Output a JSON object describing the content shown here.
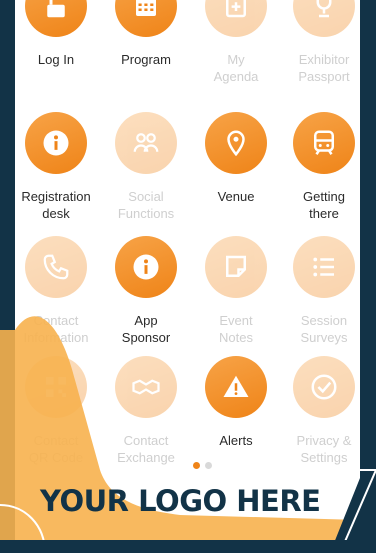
{
  "tiles": [
    {
      "label": "Log In",
      "icon": "unlock-icon",
      "active": true
    },
    {
      "label": "Program",
      "icon": "calendar-icon",
      "active": true
    },
    {
      "label": "My\nAgenda",
      "icon": "agenda-icon",
      "active": false
    },
    {
      "label": "Exhibitor\nPassport",
      "icon": "trophy-icon",
      "active": false
    },
    {
      "label": "Registration\ndesk",
      "icon": "info-icon",
      "active": true
    },
    {
      "label": "Social\nFunctions",
      "icon": "people-icon",
      "active": false
    },
    {
      "label": "Venue",
      "icon": "location-pin-icon",
      "active": true
    },
    {
      "label": "Getting\nthere",
      "icon": "train-icon",
      "active": true
    },
    {
      "label": "Contact\nInformation",
      "icon": "phone-icon",
      "active": false
    },
    {
      "label": "App\nSponsor",
      "icon": "info-icon",
      "active": true
    },
    {
      "label": "Event\nNotes",
      "icon": "note-icon",
      "active": false
    },
    {
      "label": "Session\nSurveys",
      "icon": "list-icon",
      "active": false
    },
    {
      "label": "Contact\nQR Code",
      "icon": "qr-code-icon",
      "active": false
    },
    {
      "label": "Contact\nExchange",
      "icon": "handshake-icon",
      "active": false
    },
    {
      "label": "Alerts",
      "icon": "warning-icon",
      "active": true
    },
    {
      "label": "Privacy &\nSettings",
      "icon": "check-circle-icon",
      "active": false
    }
  ],
  "branding": {
    "logo_text": "YOUR LOGO HERE",
    "accent_color": "#ef8418",
    "dark_color": "#123347"
  },
  "pagination": {
    "current": 1,
    "total": 2
  }
}
